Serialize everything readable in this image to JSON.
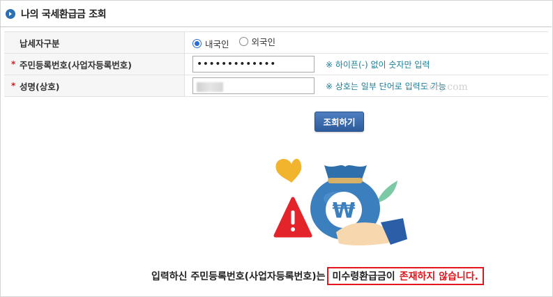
{
  "header": {
    "title": "나의 국세환급금 조회"
  },
  "form": {
    "taxpayer_type": {
      "label": "납세자구분",
      "options": [
        {
          "label": "내국인",
          "selected": true
        },
        {
          "label": "외국인",
          "selected": false
        }
      ]
    },
    "resident_number": {
      "label": "주민등록번호(사업자등록번호)",
      "value": "•••••••••••••",
      "hint": "※ 하이픈(-) 없이 숫자만 입력"
    },
    "name": {
      "label": "성명(상호)",
      "hint": "※ 상호는 일부 단어로 입력도 가능"
    }
  },
  "watermark": "tory.com",
  "search_button": {
    "label": "조회하기"
  },
  "illustration": {
    "icons": [
      "heart-icon",
      "money-bag-icon",
      "won-symbol",
      "warning-icon",
      "leaf-icon",
      "hand-icon"
    ]
  },
  "result": {
    "prefix": "입력하신 주민등록번호(사업자등록번호)는",
    "highlight": "미수령환급금이",
    "red_text": "존재하지 않습니다."
  },
  "colors": {
    "accent": "#2d6fb3",
    "hint": "#1a7d96",
    "required": "#d81b1b",
    "result_red": "#e0141b"
  }
}
